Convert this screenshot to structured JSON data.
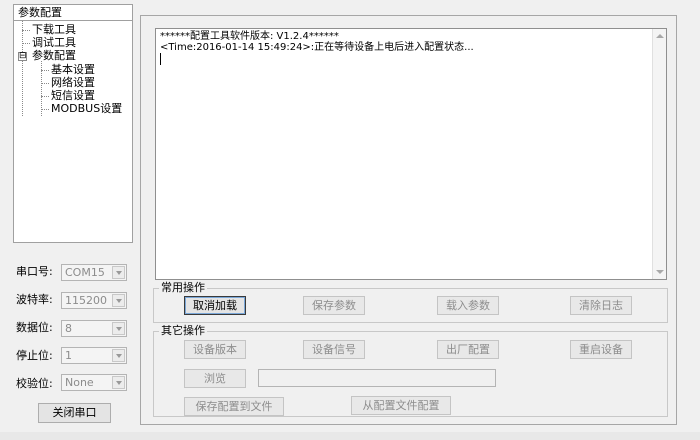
{
  "tree": {
    "header": "参数配置",
    "items": [
      {
        "label": "下载工具"
      },
      {
        "label": "调试工具"
      },
      {
        "label": "参数配置",
        "expander": "⊟"
      },
      {
        "label": "基本设置"
      },
      {
        "label": "网络设置"
      },
      {
        "label": "短信设置"
      },
      {
        "label": "MODBUS设置"
      }
    ]
  },
  "serial": {
    "port_label": "串口号:",
    "port_value": "COM15",
    "baud_label": "波特率:",
    "baud_value": "115200",
    "databits_label": "数据位:",
    "databits_value": "8",
    "stopbits_label": "停止位:",
    "stopbits_value": "1",
    "parity_label": "校验位:",
    "parity_value": "None",
    "close_button": "关闭串口"
  },
  "log": {
    "line1": "******配置工具软件版本: V1.2.4******",
    "line2": "<Time:2016-01-14 15:49:24>:正在等待设备上电后进入配置状态..."
  },
  "common_ops": {
    "title": "常用操作",
    "cancel_load": "取消加载",
    "save_params": "保存参数",
    "load_params": "载入参数",
    "clear_log": "清除日志"
  },
  "other_ops": {
    "title": "其它操作",
    "device_version": "设备版本",
    "device_signal": "设备信号",
    "factory_config": "出厂配置",
    "restart_device": "重启设备",
    "browse": "浏览",
    "browse_path": "",
    "save_to_file": "保存配置到文件",
    "load_from_file": "从配置文件配置"
  },
  "colors": {
    "window_bg": "#f0f0f0",
    "disabled_text": "#8d8d8d",
    "focus_border": "#7aa7d8"
  }
}
